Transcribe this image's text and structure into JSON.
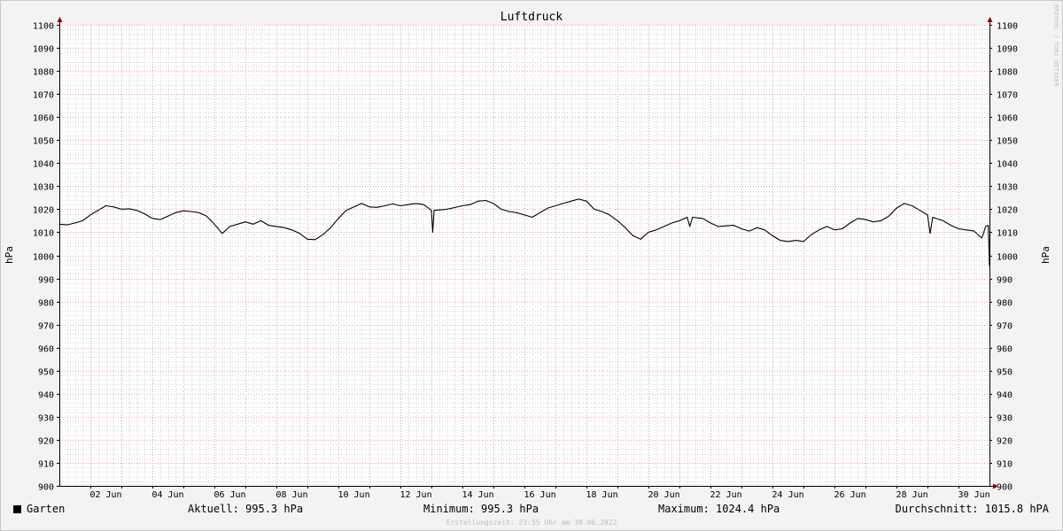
{
  "chart_data": {
    "type": "line",
    "title": "Luftdruck",
    "ylabel": "hPa",
    "ylim": [
      900,
      1100
    ],
    "yticks": [
      900,
      910,
      920,
      930,
      940,
      950,
      960,
      970,
      980,
      990,
      1000,
      1010,
      1020,
      1030,
      1040,
      1050,
      1060,
      1070,
      1080,
      1090,
      1100
    ],
    "xlim": [
      "2022-06-01",
      "2022-06-30 23:55"
    ],
    "xtick_labels": [
      "02 Jun",
      "04 Jun",
      "06 Jun",
      "08 Jun",
      "10 Jun",
      "12 Jun",
      "14 Jun",
      "16 Jun",
      "18 Jun",
      "20 Jun",
      "22 Jun",
      "24 Jun",
      "26 Jun",
      "28 Jun",
      "30 Jun"
    ],
    "grid": true,
    "series": [
      {
        "name": "Garten",
        "color": "#000000",
        "points": [
          [
            "2022-06-01 00:00",
            1013.5
          ],
          [
            "2022-06-01 06:00",
            1013.2
          ],
          [
            "2022-06-01 12:00",
            1014.0
          ],
          [
            "2022-06-01 18:00",
            1015.0
          ],
          [
            "2022-06-02 00:00",
            1017.5
          ],
          [
            "2022-06-02 06:00",
            1019.5
          ],
          [
            "2022-06-02 12:00",
            1021.5
          ],
          [
            "2022-06-02 18:00",
            1021.0
          ],
          [
            "2022-06-03 00:00",
            1020.0
          ],
          [
            "2022-06-03 06:00",
            1020.2
          ],
          [
            "2022-06-03 12:00",
            1019.5
          ],
          [
            "2022-06-03 18:00",
            1018.0
          ],
          [
            "2022-06-04 00:00",
            1016.0
          ],
          [
            "2022-06-04 06:00",
            1015.5
          ],
          [
            "2022-06-04 12:00",
            1017.0
          ],
          [
            "2022-06-04 18:00",
            1018.5
          ],
          [
            "2022-06-05 00:00",
            1019.3
          ],
          [
            "2022-06-05 06:00",
            1019.0
          ],
          [
            "2022-06-05 12:00",
            1018.5
          ],
          [
            "2022-06-05 18:00",
            1017.0
          ],
          [
            "2022-06-06 00:00",
            1013.5
          ],
          [
            "2022-06-06 06:00",
            1009.5
          ],
          [
            "2022-06-06 12:00",
            1012.5
          ],
          [
            "2022-06-06 18:00",
            1013.5
          ],
          [
            "2022-06-07 00:00",
            1014.5
          ],
          [
            "2022-06-07 06:00",
            1013.5
          ],
          [
            "2022-06-07 12:00",
            1015.0
          ],
          [
            "2022-06-07 18:00",
            1013.0
          ],
          [
            "2022-06-08 00:00",
            1012.5
          ],
          [
            "2022-06-08 06:00",
            1012.0
          ],
          [
            "2022-06-08 12:00",
            1011.0
          ],
          [
            "2022-06-08 18:00",
            1009.5
          ],
          [
            "2022-06-09 00:00",
            1007.0
          ],
          [
            "2022-06-09 06:00",
            1006.8
          ],
          [
            "2022-06-09 12:00",
            1009.0
          ],
          [
            "2022-06-09 18:00",
            1012.0
          ],
          [
            "2022-06-10 00:00",
            1016.0
          ],
          [
            "2022-06-10 06:00",
            1019.5
          ],
          [
            "2022-06-10 12:00",
            1021.0
          ],
          [
            "2022-06-10 18:00",
            1022.5
          ],
          [
            "2022-06-11 00:00",
            1021.0
          ],
          [
            "2022-06-11 06:00",
            1020.8
          ],
          [
            "2022-06-11 12:00",
            1021.5
          ],
          [
            "2022-06-11 18:00",
            1022.3
          ],
          [
            "2022-06-12 00:00",
            1021.5
          ],
          [
            "2022-06-12 06:00",
            1022.0
          ],
          [
            "2022-06-12 12:00",
            1022.5
          ],
          [
            "2022-06-12 18:00",
            1022.0
          ],
          [
            "2022-06-13 00:00",
            1019.5
          ],
          [
            "2022-06-13 01:00",
            1010.0
          ],
          [
            "2022-06-13 02:00",
            1019.5
          ],
          [
            "2022-06-13 12:00",
            1020.0
          ],
          [
            "2022-06-14 00:00",
            1021.5
          ],
          [
            "2022-06-14 06:00",
            1022.0
          ],
          [
            "2022-06-14 12:00",
            1023.5
          ],
          [
            "2022-06-14 18:00",
            1023.8
          ],
          [
            "2022-06-15 00:00",
            1022.5
          ],
          [
            "2022-06-15 06:00",
            1020.0
          ],
          [
            "2022-06-15 12:00",
            1019.0
          ],
          [
            "2022-06-15 18:00",
            1018.5
          ],
          [
            "2022-06-16 00:00",
            1017.5
          ],
          [
            "2022-06-16 06:00",
            1016.5
          ],
          [
            "2022-06-16 12:00",
            1018.5
          ],
          [
            "2022-06-16 18:00",
            1020.5
          ],
          [
            "2022-06-17 00:00",
            1021.5
          ],
          [
            "2022-06-17 06:00",
            1022.5
          ],
          [
            "2022-06-17 12:00",
            1023.5
          ],
          [
            "2022-06-17 18:00",
            1024.4
          ],
          [
            "2022-06-18 00:00",
            1023.5
          ],
          [
            "2022-06-18 06:00",
            1020.0
          ],
          [
            "2022-06-18 12:00",
            1019.0
          ],
          [
            "2022-06-18 18:00",
            1017.5
          ],
          [
            "2022-06-19 00:00",
            1015.0
          ],
          [
            "2022-06-19 06:00",
            1012.0
          ],
          [
            "2022-06-19 12:00",
            1008.5
          ],
          [
            "2022-06-19 18:00",
            1007.0
          ],
          [
            "2022-06-20 00:00",
            1010.0
          ],
          [
            "2022-06-20 06:00",
            1011.0
          ],
          [
            "2022-06-20 12:00",
            1012.5
          ],
          [
            "2022-06-20 18:00",
            1014.0
          ],
          [
            "2022-06-21 00:00",
            1015.0
          ],
          [
            "2022-06-21 06:00",
            1016.5
          ],
          [
            "2022-06-21 08:00",
            1012.5
          ],
          [
            "2022-06-21 10:00",
            1016.5
          ],
          [
            "2022-06-21 18:00",
            1016.0
          ],
          [
            "2022-06-22 00:00",
            1014.0
          ],
          [
            "2022-06-22 06:00",
            1012.5
          ],
          [
            "2022-06-22 12:00",
            1012.8
          ],
          [
            "2022-06-22 18:00",
            1013.0
          ],
          [
            "2022-06-23 00:00",
            1011.5
          ],
          [
            "2022-06-23 06:00",
            1010.5
          ],
          [
            "2022-06-23 12:00",
            1012.0
          ],
          [
            "2022-06-23 18:00",
            1011.0
          ],
          [
            "2022-06-24 00:00",
            1008.5
          ],
          [
            "2022-06-24 06:00",
            1006.5
          ],
          [
            "2022-06-24 12:00",
            1006.0
          ],
          [
            "2022-06-24 18:00",
            1006.5
          ],
          [
            "2022-06-25 00:00",
            1006.0
          ],
          [
            "2022-06-25 06:00",
            1009.0
          ],
          [
            "2022-06-25 12:00",
            1011.0
          ],
          [
            "2022-06-25 18:00",
            1012.5
          ],
          [
            "2022-06-26 00:00",
            1011.0
          ],
          [
            "2022-06-26 06:00",
            1011.5
          ],
          [
            "2022-06-26 12:00",
            1014.0
          ],
          [
            "2022-06-26 18:00",
            1016.0
          ],
          [
            "2022-06-27 00:00",
            1015.5
          ],
          [
            "2022-06-27 06:00",
            1014.5
          ],
          [
            "2022-06-27 12:00",
            1015.0
          ],
          [
            "2022-06-27 18:00",
            1017.0
          ],
          [
            "2022-06-28 00:00",
            1020.5
          ],
          [
            "2022-06-28 06:00",
            1022.5
          ],
          [
            "2022-06-28 12:00",
            1021.5
          ],
          [
            "2022-06-28 18:00",
            1019.5
          ],
          [
            "2022-06-29 00:00",
            1017.5
          ],
          [
            "2022-06-29 02:00",
            1009.5
          ],
          [
            "2022-06-29 04:00",
            1016.5
          ],
          [
            "2022-06-29 12:00",
            1015.0
          ],
          [
            "2022-06-29 18:00",
            1013.0
          ],
          [
            "2022-06-30 00:00",
            1011.5
          ],
          [
            "2022-06-30 06:00",
            1011.0
          ],
          [
            "2022-06-30 12:00",
            1010.5
          ],
          [
            "2022-06-30 18:00",
            1007.5
          ],
          [
            "2022-06-30 21:00",
            1012.5
          ],
          [
            "2022-06-30 23:00",
            1013.0
          ],
          [
            "2022-06-30 23:55",
            995.3
          ]
        ]
      }
    ],
    "colors": {
      "grid_minor": "#d6d6d6",
      "grid_major": "#e8a4a4",
      "axis": "#000000",
      "arrow": "#8b0000"
    }
  },
  "legend": {
    "series_name": "Garten",
    "current": "Aktuell: 995.3 hPa",
    "minimum": "Minimum: 995.3 hPa",
    "maximum": "Maximum: 1024.4 hPa",
    "average": "Durchschnitt: 1015.8 hPA"
  },
  "footer": "Erstellungszeit: 23:55 Uhr am 30.06.2022",
  "watermark": "RRDTOOL / TOBI OETIKER"
}
